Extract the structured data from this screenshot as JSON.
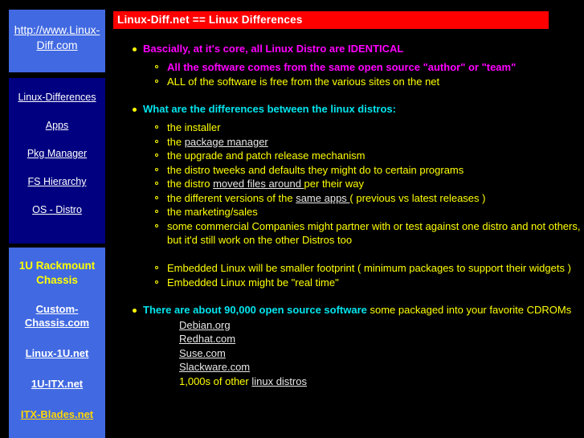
{
  "page": {
    "title_bar": "Linux-Diff.net == Linux Differences",
    "background_color": "#000000",
    "title_bar_color": "#ff0000"
  },
  "sidebar": {
    "logo_box": {
      "background": "#4169E1",
      "link": "http://www.Linux-Diff.com"
    },
    "nav_box": {
      "background": "#000080",
      "items": [
        {
          "label": "Linux-Differences "
        },
        {
          "label": "Apps "
        },
        {
          "label": "Pkg Manager "
        },
        {
          "label": "FS Hierarchy "
        },
        {
          "label": "OS - Distro "
        }
      ]
    },
    "promo_box": {
      "background": "#4169E1",
      "title_line1": "1U Rackmount",
      "title_line2": "Chassis",
      "title_color": "#ffff00",
      "links": [
        {
          "label": "Custom-",
          "accent": false
        },
        {
          "label": "Chassis.com",
          "accent": false
        },
        {
          "label": "Linux-1U.net",
          "accent": false
        },
        {
          "label": "1U-ITX.net",
          "accent": false
        },
        {
          "label": "ITX-Blades.net",
          "accent": true,
          "color": "#ffd700"
        }
      ]
    }
  },
  "main": {
    "section1": {
      "heading": "Bascially, at it's core, all Linux Distro are IDENTICAL",
      "heading_color": "#ff00ff",
      "items": [
        {
          "text": "All the software comes from the same open source \"author\" or \"team\"",
          "style": "magenta-bold"
        },
        {
          "text": "ALL of the software is free from the various sites on the net",
          "style": "yellow"
        }
      ]
    },
    "section2": {
      "heading": "What are the differences between the linux distros:",
      "heading_color": "#00e5ee",
      "items": [
        {
          "pre": "the installer",
          "link": "",
          "post": ""
        },
        {
          "pre": "the ",
          "link": "package manager",
          "post": ""
        },
        {
          "pre": "the upgrade and patch release mechanism",
          "link": "",
          "post": ""
        },
        {
          "pre": "the distro tweeks and defaults they might do to certain programs",
          "link": "",
          "post": ""
        },
        {
          "pre": "the distro ",
          "link": "moved files around ",
          "post": "per their way"
        },
        {
          "pre": "the different versions of the ",
          "link": "same apps ",
          "post": "( previous vs latest releases )"
        },
        {
          "pre": "the marketing/sales",
          "link": "",
          "post": ""
        },
        {
          "pre": "some commercial Companies might partner with or test against one distro and not others,",
          "link": "",
          "post": ""
        }
      ],
      "continuation": "but it'd still work on the other Distros too",
      "items_after_gap": [
        {
          "text": "Embedded Linux will be smaller footprint ( minimum packages to support their widgets )"
        },
        {
          "text": "Embedded Linux might be \"real time\""
        }
      ]
    },
    "section3": {
      "heading_bold": "There are about 90,000 open source software",
      "heading_bold_color": "#00e5ee",
      "heading_rest": " some packaged into your favorite CDROMs",
      "heading_rest_color": "#ffff00",
      "distro_links": [
        "Debian.org ",
        "Redhat.com ",
        "Suse.com ",
        "Slackware.com "
      ],
      "last_line_pre": "1,000s of other ",
      "last_line_link": "linux distros"
    }
  }
}
